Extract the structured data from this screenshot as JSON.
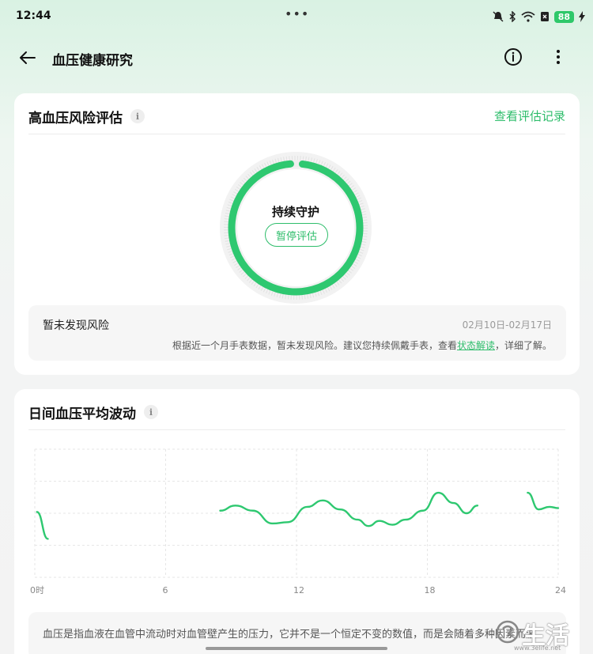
{
  "status_bar": {
    "time": "12:44",
    "dots": "•••",
    "battery": "88"
  },
  "header": {
    "title": "血压健康研究"
  },
  "risk_card": {
    "title": "高血压风险评估",
    "info": "i",
    "link": "查看评估记录",
    "ring_status": "持续守护",
    "ring_progress": 0.97,
    "pause_button": "暂停评估",
    "result_title": "暂未发现风险",
    "result_date": "02月10日-02月17日",
    "result_desc_prefix": "根据近一个月手表数据，暂未发现风险。建议您持续佩戴手表，查看",
    "result_desc_link": "状态解读",
    "result_desc_suffix": "，详细了解。",
    "accent_color": "#2ebd6b"
  },
  "fluctuation_card": {
    "title": "日间血压平均波动",
    "info": "i",
    "description": "血压是指血液在血管中流动时对血管壁产生的压力，它并不是一个恒定不变的数值，而是会随着多种因素而波"
  },
  "chart_data": {
    "type": "line",
    "x_ticks": [
      "0时",
      "6",
      "12",
      "18",
      "24"
    ],
    "xlim": [
      0,
      24
    ],
    "series": [
      {
        "segments": [
          [
            [
              0.1,
              0.51
            ],
            [
              0.6,
              0.3
            ]
          ],
          [
            [
              8.5,
              0.52
            ],
            [
              9.2,
              0.56
            ],
            [
              10.0,
              0.52
            ],
            [
              10.9,
              0.42
            ],
            [
              11.6,
              0.43
            ],
            [
              12.5,
              0.55
            ],
            [
              13.2,
              0.6
            ],
            [
              14.0,
              0.53
            ],
            [
              14.8,
              0.45
            ],
            [
              15.3,
              0.4
            ],
            [
              15.8,
              0.44
            ],
            [
              16.4,
              0.41
            ],
            [
              17.0,
              0.45
            ],
            [
              17.8,
              0.52
            ],
            [
              18.5,
              0.66
            ],
            [
              19.2,
              0.58
            ],
            [
              19.8,
              0.5
            ],
            [
              20.3,
              0.56
            ]
          ],
          [
            [
              22.6,
              0.66
            ],
            [
              23.1,
              0.53
            ],
            [
              23.6,
              0.55
            ],
            [
              24.0,
              0.54
            ]
          ]
        ]
      }
    ],
    "grid": true,
    "line_color": "#2ec870"
  },
  "watermark": {
    "brand": "生活",
    "url": "www.3elife.net"
  }
}
